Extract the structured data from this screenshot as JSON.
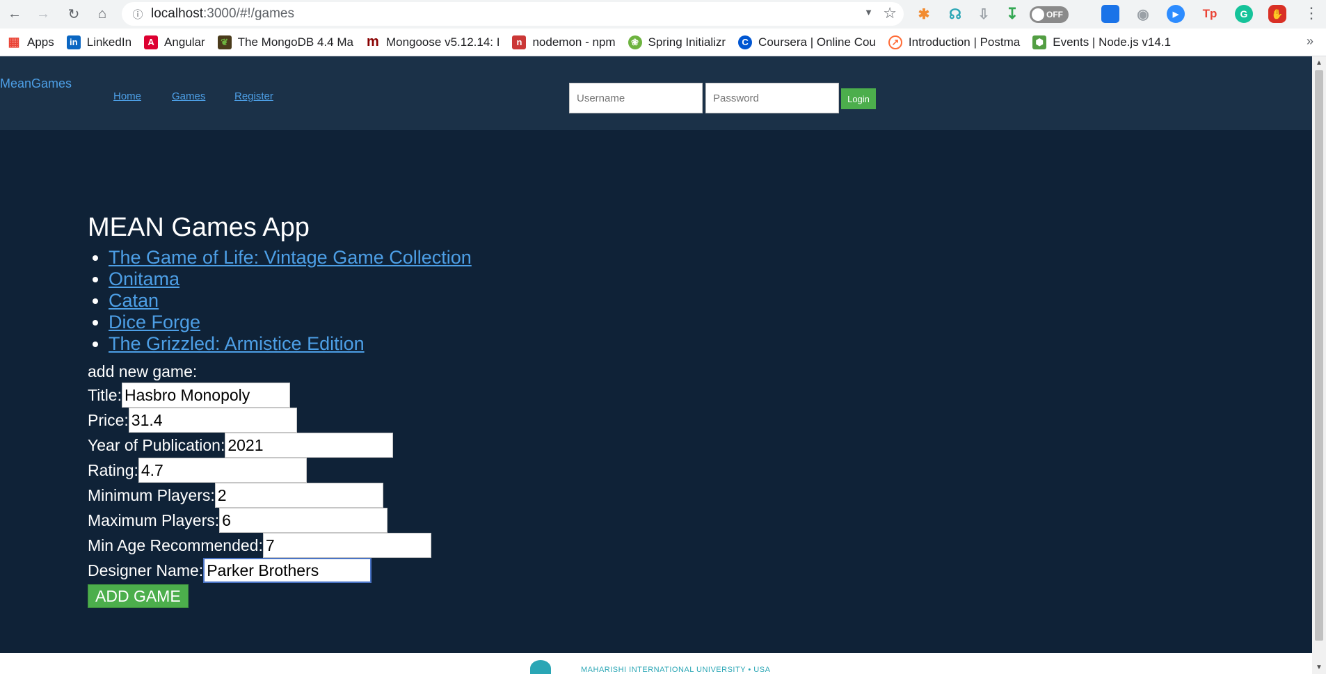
{
  "browser": {
    "url_host": "localhost",
    "url_path": ":3000/#!/games",
    "toggle_label": "OFF"
  },
  "bookmarks": [
    {
      "label": "Apps",
      "icon": "apps-grid-icon",
      "color": "#ea4335"
    },
    {
      "label": "LinkedIn",
      "icon": "linkedin-icon",
      "color": "#0a66c2"
    },
    {
      "label": "Angular",
      "icon": "angular-icon",
      "color": "#dd0031"
    },
    {
      "label": "The MongoDB 4.4 Ma",
      "icon": "mongodb-icon",
      "color": "#4a3b1b"
    },
    {
      "label": "Mongoose v5.12.14: I",
      "icon": "mongoose-icon",
      "color": "#880000"
    },
    {
      "label": "nodemon - npm",
      "icon": "npm-icon",
      "color": "#cb3837"
    },
    {
      "label": "Spring Initializr",
      "icon": "spring-icon",
      "color": "#6db33f"
    },
    {
      "label": "Coursera | Online Cou",
      "icon": "coursera-icon",
      "color": "#0056d2"
    },
    {
      "label": "Introduction | Postma",
      "icon": "postman-icon",
      "color": "#ff6c37"
    },
    {
      "label": "Events | Node.js v14.1",
      "icon": "nodejs-icon",
      "color": "#539e43"
    }
  ],
  "navbar": {
    "brand": "MeanGames",
    "links": [
      "Home",
      "Games",
      "Register"
    ],
    "username_placeholder": "Username",
    "password_placeholder": "Password",
    "login_label": "Login"
  },
  "main": {
    "title": "MEAN Games App",
    "games": [
      "The Game of Life: Vintage Game Collection",
      "Onitama",
      "Catan",
      "Dice Forge",
      "The Grizzled: Armistice Edition"
    ],
    "form_heading": "add new game:",
    "fields": [
      {
        "label": "Title:",
        "value": "Hasbro Monopoly"
      },
      {
        "label": "Price:",
        "value": "31.4"
      },
      {
        "label": "Year of Publication:",
        "value": "2021"
      },
      {
        "label": "Rating:",
        "value": "4.7"
      },
      {
        "label": "Minimum Players:",
        "value": "2"
      },
      {
        "label": "Maximum Players:",
        "value": "6"
      },
      {
        "label": "Min Age Recommended:",
        "value": "7"
      },
      {
        "label": "Designer Name:",
        "value": "Parker Brothers"
      }
    ],
    "add_button": "ADD GAME"
  },
  "footer": {
    "text": "MAHARISHI INTERNATIONAL UNIVERSITY • USA"
  }
}
